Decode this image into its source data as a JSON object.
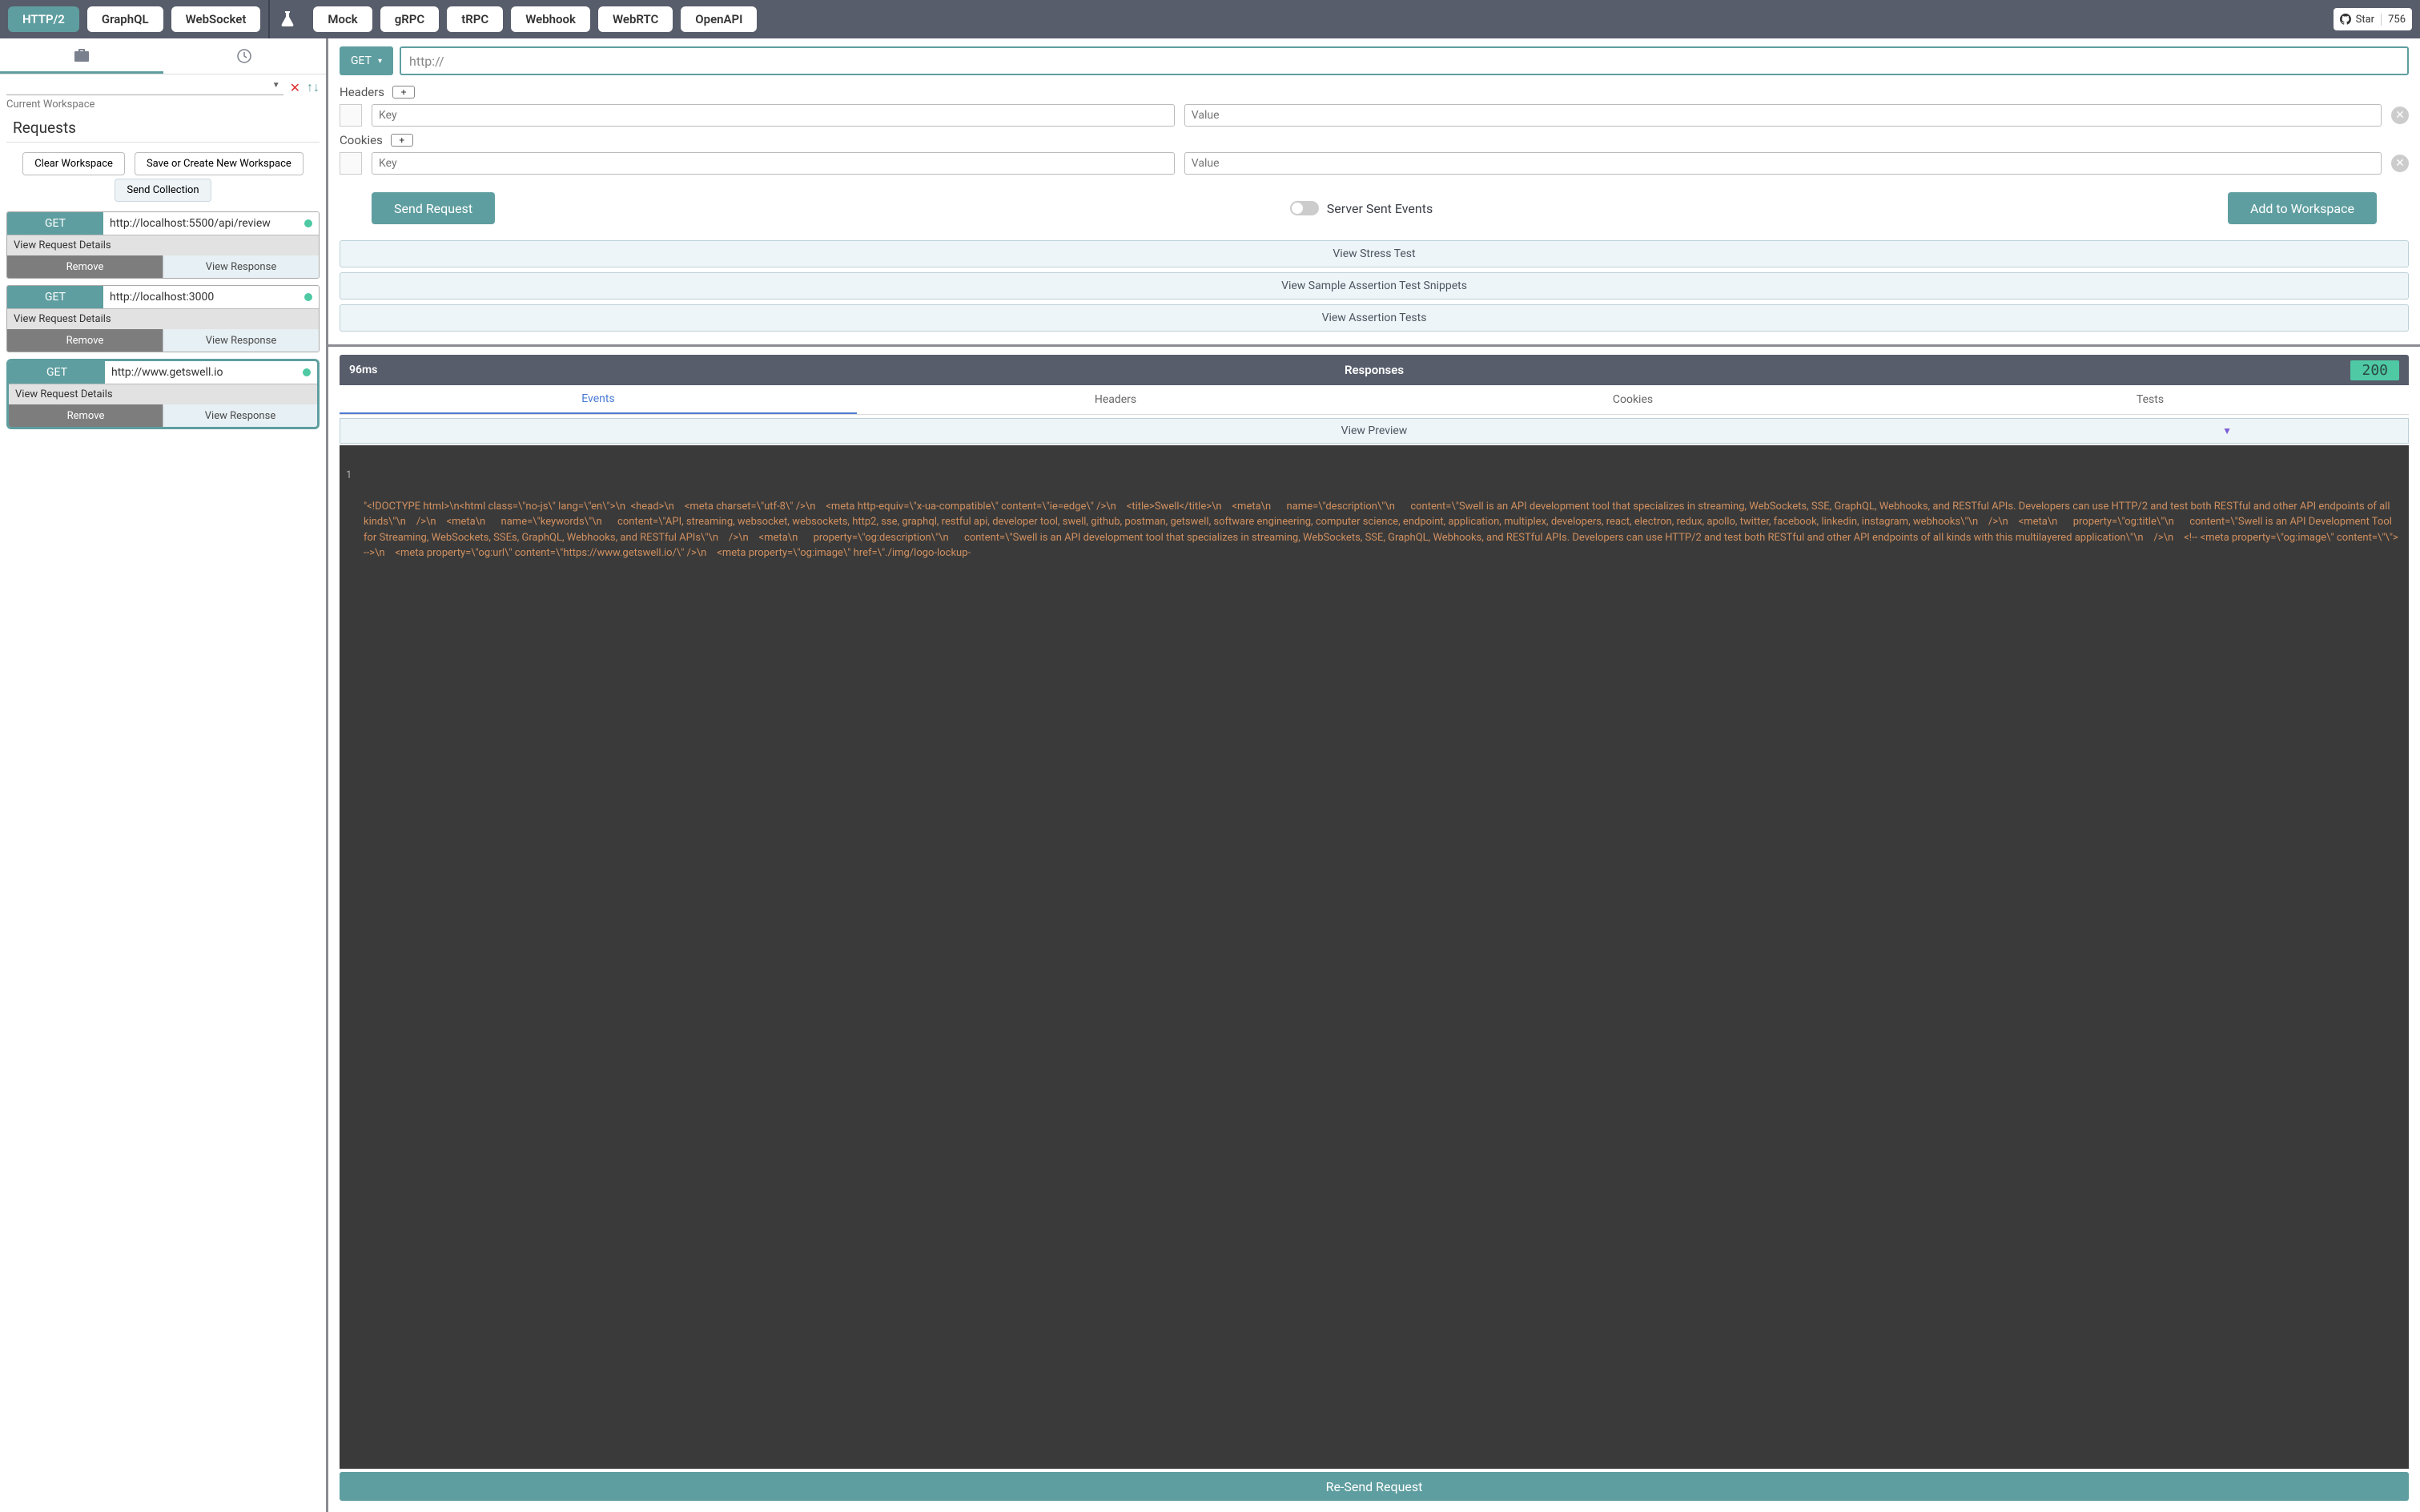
{
  "topbar": {
    "left": [
      "HTTP/2",
      "GraphQL",
      "WebSocket"
    ],
    "right": [
      "Mock",
      "gRPC",
      "tRPC",
      "Webhook",
      "WebRTC",
      "OpenAPI"
    ],
    "star_label": "Star",
    "star_count": "756"
  },
  "sidebar": {
    "current_ws": "Current Workspace",
    "requests_hdr": "Requests",
    "clear_btn": "Clear Workspace",
    "save_btn": "Save or Create New Workspace",
    "send_coll": "Send Collection",
    "view_details": "View Request Details",
    "remove": "Remove",
    "view_response": "View Response",
    "items": [
      {
        "method": "GET",
        "url": "http://localhost:5500/api/review"
      },
      {
        "method": "GET",
        "url": "http://localhost:3000"
      },
      {
        "method": "GET",
        "url": "http://www.getswell.io"
      }
    ]
  },
  "composer": {
    "method": "GET",
    "url": "http://",
    "headers_label": "Headers",
    "cookies_label": "Cookies",
    "key_ph": "Key",
    "value_ph": "Value",
    "send_btn": "Send Request",
    "sse_label": "Server Sent Events",
    "add_btn": "Add to Workspace",
    "stress": "View Stress Test",
    "snippets": "View Sample Assertion Test Snippets",
    "assertions": "View Assertion Tests"
  },
  "response": {
    "time": "96ms",
    "title": "Responses",
    "status": "200",
    "tabs": [
      "Events",
      "Headers",
      "Cookies",
      "Tests"
    ],
    "preview_label": "View Preview",
    "resend": "Re-Send Request",
    "body": "\"<!DOCTYPE html>\\n<html class=\\\"no-js\\\" lang=\\\"en\\\">\\n  <head>\\n    <meta charset=\\\"utf-8\\\" />\\n    <meta http-equiv=\\\"x-ua-compatible\\\" content=\\\"ie=edge\\\" />\\n    <title>Swell</title>\\n    <meta\\n      name=\\\"description\\\"\\n      content=\\\"Swell is an API development tool that specializes in streaming, WebSockets, SSE, GraphQL, Webhooks, and RESTful APIs. Developers can use HTTP/2 and test both RESTful and other API endpoints of all kinds\\\"\\n    />\\n    <meta\\n      name=\\\"keywords\\\"\\n      content=\\\"API, streaming, websocket, websockets, http2, sse, graphql, restful api, developer tool, swell, github, postman, getswell, software engineering, computer science, endpoint, application, multiplex, developers, react, electron, redux, apollo, twitter, facebook, linkedin, instagram, webhooks\\\"\\n    />\\n    <meta\\n      property=\\\"og:title\\\"\\n      content=\\\"Swell is an API Development Tool for Streaming, WebSockets, SSEs, GraphQL, Webhooks, and RESTful APIs\\\"\\n    />\\n    <meta\\n      property=\\\"og:description\\\"\\n      content=\\\"Swell is an API development tool that specializes in streaming, WebSockets, SSE, GraphQL, Webhooks, and RESTful APIs. Developers can use HTTP/2 and test both RESTful and other API endpoints of all kinds with this multilayered application\\\"\\n    />\\n    <!-- <meta property=\\\"og:image\\\" content=\\\"\\\"> -->\\n    <meta property=\\\"og:url\\\" content=\\\"https://www.getswell.io/\\\" />\\n    <meta property=\\\"og:image\\\" href=\\\"./img/logo-lockup-"
  }
}
